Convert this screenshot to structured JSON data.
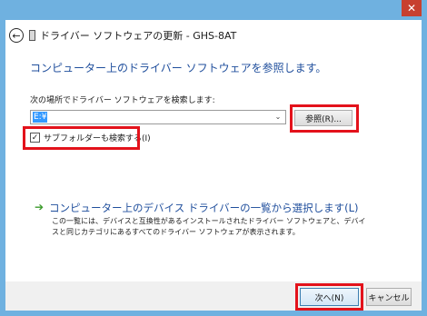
{
  "window": {
    "title": "ドライバー ソフトウェアの更新 - GHS-8AT",
    "close_glyph": "✕"
  },
  "main": {
    "heading": "コンピューター上のドライバー ソフトウェアを参照します。",
    "search_label": "次の場所でドライバー ソフトウェアを検索します:",
    "path_value": "E:¥",
    "browse_label": "参照(R)...",
    "subfolder_label": "サブフォルダーも検索する(I)",
    "subfolder_checked": true,
    "pick_title": "コンピューター上のデバイス ドライバーの一覧から選択します(L)",
    "pick_desc": "この一覧には、デバイスと互換性があるインストールされたドライバー ソフトウェアと、デバイスと同じカテゴリにあるすべてのドライバー ソフトウェアが表示されます。"
  },
  "footer": {
    "next_label": "次へ(N)",
    "cancel_label": "キャンセル"
  },
  "colors": {
    "frame": "#6fb1e0",
    "heading": "#1f4e9c",
    "highlight": "#e3121b",
    "arrow": "#3c9b2c"
  },
  "icons": {
    "back": "back-arrow-icon",
    "device": "device-icon",
    "pick_arrow": "green-arrow-icon",
    "combo": "chevron-down-icon",
    "checkbox": "checkmark-icon"
  }
}
